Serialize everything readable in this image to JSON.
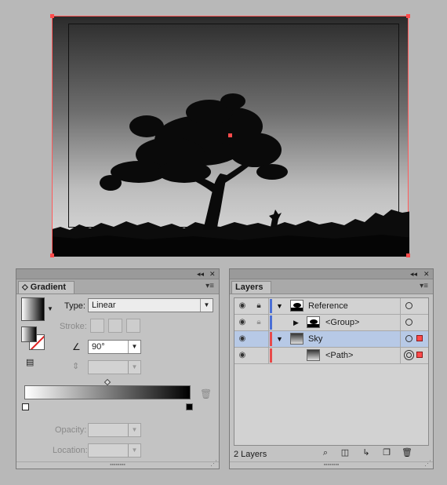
{
  "artboard": {
    "name": "Artboard"
  },
  "gradient_panel": {
    "tab_label": "Gradient",
    "collapse_glyph": "◂◂",
    "close_glyph": "✕",
    "menu_glyph": "▾≡",
    "type_label": "Type:",
    "type_value": "Linear",
    "stroke_label": "Stroke:",
    "angle_value": "90°",
    "aspect_value": "",
    "opacity_label": "Opacity:",
    "opacity_value": "",
    "location_label": "Location:",
    "location_value": "",
    "gradient_stops": [
      {
        "color": "#ffffff",
        "position": 0
      },
      {
        "color": "#000000",
        "position": 100
      }
    ]
  },
  "layers_panel": {
    "tab_label": "Layers",
    "collapse_glyph": "◂◂",
    "close_glyph": "✕",
    "menu_glyph": "▾≡",
    "layer_count": "2 Layers",
    "layers": [
      {
        "name": "Reference",
        "expanded": true,
        "locked": true,
        "color": "#4a6fd6",
        "selected": false
      },
      {
        "name": "<Group>",
        "expanded": false,
        "locked": true,
        "color": "#4a6fd6",
        "selected": false
      },
      {
        "name": "Sky",
        "expanded": true,
        "locked": false,
        "color": "#e84a4a",
        "selected": true
      },
      {
        "name": "<Path>",
        "expanded": false,
        "locked": false,
        "color": "#e84a4a",
        "selected": false
      }
    ]
  },
  "colors": {
    "selection": "#ff4b4b",
    "layer_highlight": "#b7c9e6",
    "panel_bg": "#c3c3c3"
  }
}
